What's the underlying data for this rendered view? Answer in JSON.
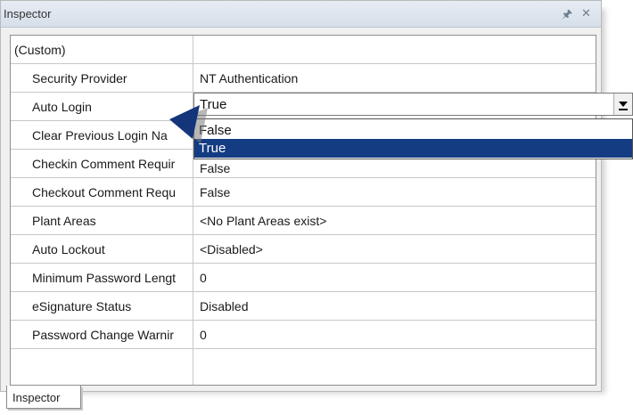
{
  "window": {
    "title": "Inspector",
    "pin_icon": "pin-icon",
    "close_icon": "close-icon"
  },
  "properties": [
    {
      "name": "(Custom)",
      "value": "",
      "indent": false
    },
    {
      "name": "Security Provider",
      "value": "NT Authentication",
      "indent": true
    },
    {
      "name": "Auto Login",
      "value": "True",
      "indent": true
    },
    {
      "name": "Clear Previous Login Na",
      "value": "",
      "indent": true
    },
    {
      "name": "Checkin Comment Requir",
      "value": "False",
      "indent": true
    },
    {
      "name": "Checkout Comment Requ",
      "value": "False",
      "indent": true
    },
    {
      "name": "Plant Areas",
      "value": "<No Plant Areas exist>",
      "indent": true
    },
    {
      "name": "Auto Lockout",
      "value": "<Disabled>",
      "indent": true
    },
    {
      "name": "Minimum Password Lengt",
      "value": "0",
      "indent": true
    },
    {
      "name": "eSignature Status",
      "value": "Disabled",
      "indent": true
    },
    {
      "name": "Password Change Warnir",
      "value": "0",
      "indent": true
    }
  ],
  "editor": {
    "selected_value": "True",
    "options": [
      "False",
      "True"
    ],
    "highlighted_option": "True",
    "highlight_color": "#143c82"
  },
  "tab": {
    "label": "Inspector"
  }
}
